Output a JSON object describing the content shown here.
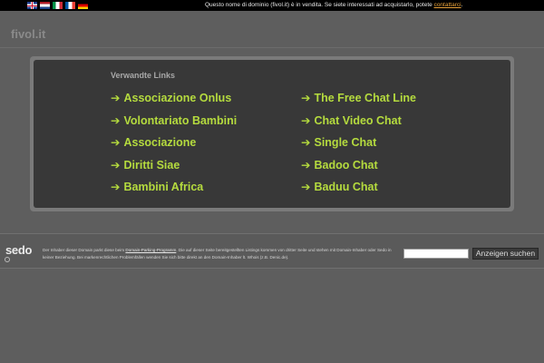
{
  "top_bar": {
    "flags": [
      "uk-flag-icon",
      "netherlands-flag-icon",
      "italy-flag-icon",
      "france-flag-icon",
      "germany-flag-icon"
    ],
    "notice_text": "Questo nome di dominio (fivol.it) è in vendita. Se siete interessati ad acquistarlo, potete",
    "notice_link": "contattarci",
    "notice_end": "."
  },
  "header": {
    "domain": "fivol.it"
  },
  "related_links": {
    "heading": "Verwandte Links",
    "arrow": "➔",
    "left": [
      "Associazione Onlus",
      "Volontariato Bambini",
      "Associazione",
      "Diritti Siae",
      "Bambini Africa"
    ],
    "right": [
      "The Free Chat Line",
      "Chat Video Chat",
      "Single Chat",
      "Badoo Chat",
      "Baduu Chat"
    ]
  },
  "footer": {
    "logo": "sedo",
    "disclaimer_1": "Der Inhaber dieser Domain parkt diese beim",
    "disclaimer_link": "Domain-Parking-Programm",
    "disclaimer_2": ". Die auf dieser Seite bereitgestellten Listings kommen von dritter Seite und stehen mit Domain-Inhaber oder Sedo in keiner Beziehung. Bei markenrechtlichen Problemfällen wenden Sie sich bitte direkt an den Domain-Inhaber lt. Whois (z.B. Denic.de).",
    "search_placeholder": "",
    "search_button": "Anzeigen suchen"
  },
  "colors": {
    "link_green": "#b5db3e",
    "background": "#5e5e5e",
    "panel": "#383838"
  }
}
